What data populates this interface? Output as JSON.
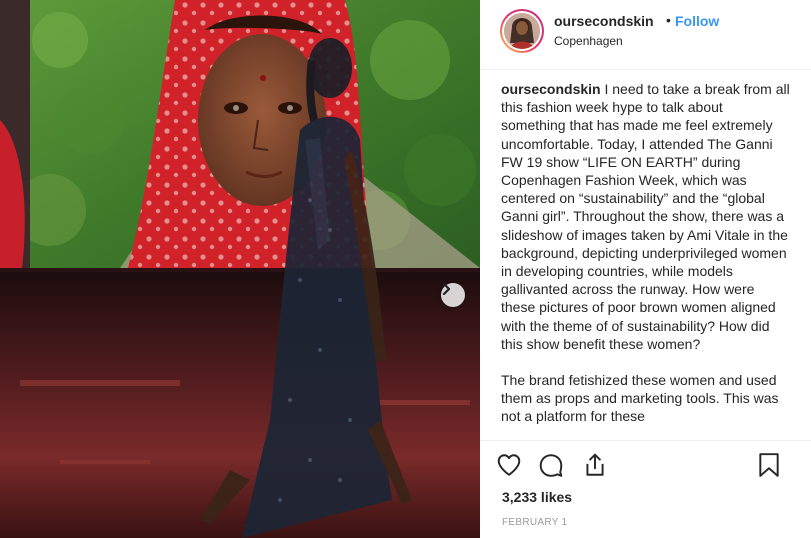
{
  "post": {
    "image_alt": "Runway model walking in front of a large screen showing a girl in a red headscarf",
    "next_icon": "chevron-right-icon"
  },
  "header": {
    "username": "oursecondskin",
    "separator": "•",
    "follow_label": "Follow",
    "location": "Copenhagen"
  },
  "caption": {
    "username": "oursecondskin",
    "paragraph_1": "I need to take a break from all this fashion week hype to talk about something that has made me feel extremely uncomfortable. Today, I attended The Ganni FW 19 show “LIFE ON EARTH” during Copenhagen Fashion Week, which was centered on “sustainability” and the “global Ganni girl”. Throughout the show, there was a slideshow of images taken by Ami Vitale in the background, depicting underprivileged women in developing countries, while models gallivanted across the runway. How were these pictures of poor brown women aligned with the theme of of sustainability? How did this show benefit these women?",
    "paragraph_2": "The brand fetishized these women and used them as props and marketing tools. This was not a platform for these"
  },
  "actions": {
    "like_icon": "heart-icon",
    "comment_icon": "comment-icon",
    "share_icon": "share-icon",
    "save_icon": "bookmark-icon"
  },
  "likes": "3,233 likes",
  "date": "FEBRUARY 1",
  "colors": {
    "link_blue": "#3897f0",
    "text": "#262626",
    "muted": "#999999",
    "divider": "#efefef"
  }
}
